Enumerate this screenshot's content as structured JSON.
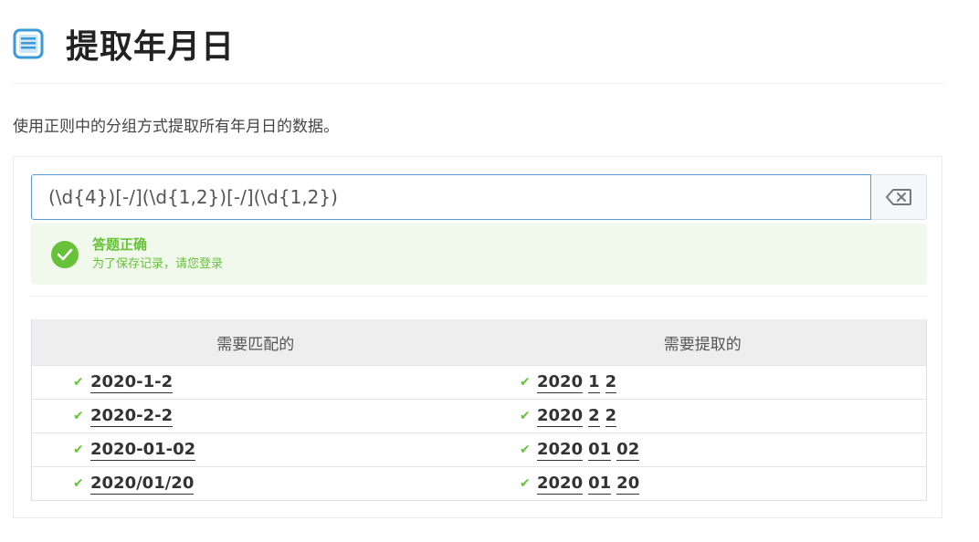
{
  "page": {
    "title": "提取年月日",
    "description": "使用正则中的分组方式提取所有年月日的数据。"
  },
  "regex": {
    "value": "(\\d{4})[-/](\\d{1,2})[-/](\\d{1,2})"
  },
  "alert": {
    "title": "答题正确",
    "description": "为了保存记录，请您登录"
  },
  "table": {
    "headers": [
      "需要匹配的",
      "需要提取的"
    ],
    "rows": [
      {
        "match": "2020-1-2",
        "groups": [
          "2020",
          "1",
          "2"
        ]
      },
      {
        "match": "2020-2-2",
        "groups": [
          "2020",
          "2",
          "2"
        ]
      },
      {
        "match": "2020-01-02",
        "groups": [
          "2020",
          "01",
          "02"
        ]
      },
      {
        "match": "2020/01/20",
        "groups": [
          "2020",
          "01",
          "20"
        ]
      }
    ]
  },
  "icons": {
    "title_icon": "document-icon",
    "clear_icon": "backspace-icon",
    "alert_icon": "check-circle-icon",
    "row_icon": "check-icon"
  },
  "colors": {
    "success": "#67c23a",
    "success_bg": "#f0f9eb",
    "input_border": "#5b9bd5",
    "icon_blue": "#3a9ad9"
  }
}
